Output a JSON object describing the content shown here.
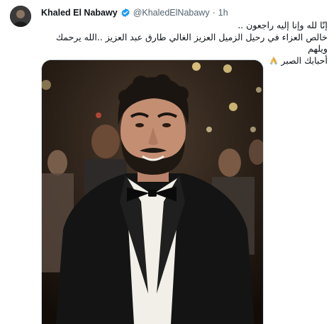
{
  "tweet": {
    "author_name": "Khaled El Nabawy",
    "handle": "@KhaledElNabawy",
    "separator": "·",
    "time": "1h",
    "lines": [
      "إنّا لله وإنا إليه راجعون ..",
      "خالص العزاء في رحيل الزميل العزيز الغالي طارق عبد العزيز ..الله يرحمك ويلهم",
      "أحبابك الصبر"
    ],
    "emoji": "praying-hands",
    "verified_color": "#1d9bf0"
  }
}
